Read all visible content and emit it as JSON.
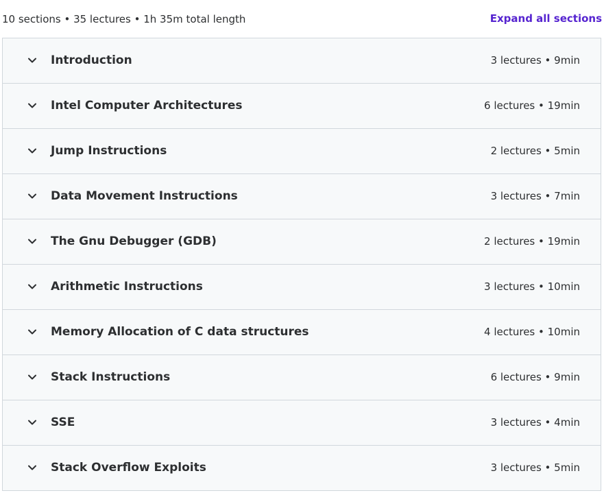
{
  "curriculum": {
    "summary": "10 sections • 35 lectures • 1h 35m total length",
    "expand_label": "Expand all sections",
    "accent_color": "#5624d0",
    "sections": [
      {
        "title": "Introduction",
        "meta": "3 lectures • 9min"
      },
      {
        "title": "Intel Computer Architectures",
        "meta": "6 lectures • 19min"
      },
      {
        "title": "Jump Instructions",
        "meta": "2 lectures • 5min"
      },
      {
        "title": "Data Movement Instructions",
        "meta": "3 lectures • 7min"
      },
      {
        "title": "The Gnu Debugger (GDB)",
        "meta": "2 lectures • 19min"
      },
      {
        "title": "Arithmetic Instructions",
        "meta": "3 lectures • 10min"
      },
      {
        "title": "Memory Allocation of C data structures",
        "meta": "4 lectures • 10min"
      },
      {
        "title": "Stack Instructions",
        "meta": "6 lectures • 9min"
      },
      {
        "title": "SSE",
        "meta": "3 lectures • 4min"
      },
      {
        "title": "Stack Overflow Exploits",
        "meta": "3 lectures • 5min"
      }
    ]
  }
}
